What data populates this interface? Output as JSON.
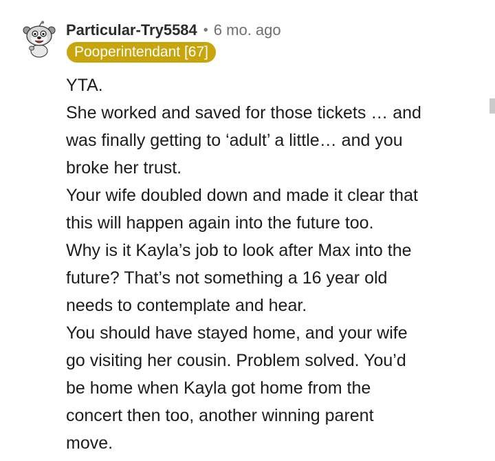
{
  "comment": {
    "username": "Particular-Try5584",
    "separator": "•",
    "timestamp": "6 mo. ago",
    "flair": "Pooperintendant [67]",
    "body_lines": [
      "YTA.",
      "She worked and saved for those tickets … and",
      "was finally getting to ‘adult’ a little… and you",
      "broke her trust.",
      "Your wife doubled down and made it clear that",
      "this will happen again into the future too.",
      "Why is it Kayla’s job to look after Max into the",
      "future? That’s not something a 16 year old",
      "needs to contemplate and hear.",
      "You should have stayed home, and your wife",
      "go visiting her cousin. Problem solved. You’d",
      "be home when Kayla got home from the",
      "concert then too, another winning parent",
      "move."
    ]
  },
  "colors": {
    "flair_background": "#c8a50c",
    "flair_text": "#ffffff",
    "username": "#2b2b2b",
    "timestamp": "#6f6f6f",
    "body_text": "#1c1c1c"
  },
  "icons": {
    "avatar": "snoo-avatar-icon",
    "scrollbar": "scrollbar-thumb"
  }
}
